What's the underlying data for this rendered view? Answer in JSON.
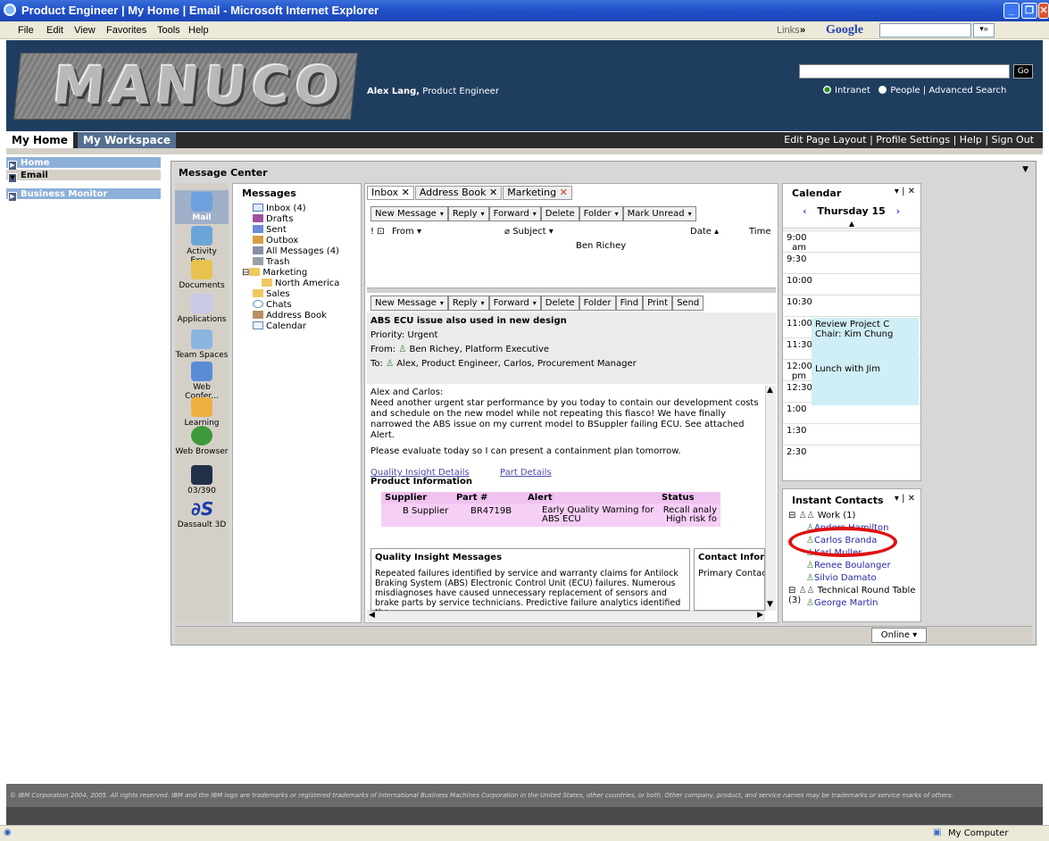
{
  "window": {
    "title": "Product Engineer | My Home | Email - Microsoft Internet Explorer"
  },
  "menu": {
    "items": [
      "File",
      "Edit",
      "View",
      "Favorites",
      "Tools",
      "Help"
    ],
    "links_label": "Links",
    "google_label": "Google"
  },
  "banner": {
    "logo_text": "MANUCO",
    "user_name": "Alex Lang,",
    "user_role": "Product Engineer",
    "go_label": "Go",
    "search_options": [
      "Intranet",
      "People"
    ],
    "advanced_search": "Advanced Search"
  },
  "nav": {
    "tab_home": "My Home",
    "tab_workspace": "My Workspace",
    "top_links": "Edit Page Layout | Profile Settings | Help | Sign Out"
  },
  "left_nav": [
    "Home",
    "Email",
    "Business Monitor"
  ],
  "message_center": {
    "title": "Message Center",
    "icons": [
      "Mail",
      "Activity Exp...",
      "Documents",
      "Applications",
      "Team Spaces",
      "Web Confer...",
      "Learning",
      "Web Browser",
      "03/390",
      "Dassault 3D"
    ],
    "folders_title": "Messages",
    "folders": [
      "Inbox (4)",
      "Drafts",
      "Sent",
      "Outbox",
      "All Messages (4)",
      "Trash",
      "Marketing",
      "North America",
      "Sales",
      "Chats",
      "Address Book",
      "Calendar"
    ],
    "tabs": [
      "Inbox",
      "Address Book",
      "Marketing"
    ],
    "toolbar1": [
      "New Message",
      "Reply",
      "Forward",
      "Delete",
      "Folder",
      "Mark Unread"
    ],
    "columns": [
      "From",
      "Subject",
      "Date",
      "Time"
    ],
    "list_sender": "Ben Richey",
    "toolbar2": [
      "New Message",
      "Reply",
      "Forward",
      "Delete",
      "Folder",
      "Find",
      "Print",
      "Send"
    ],
    "message": {
      "subject": "ABS ECU issue also used in new design",
      "priority": "Priority: Urgent",
      "from_label": "From:",
      "from": "Ben Richey, Platform Executive",
      "to_label": "To:",
      "to": "Alex, Product Engineer, Carlos, Procurement Manager",
      "greeting": "Alex and Carlos:",
      "body1": "Need another urgent star performance by you today to contain our development costs and schedule on the new model while not repeating this fiasco! We have finally narrowed the ABS issue on my current model to BSuppler failing ECU. See attached Alert.",
      "body2": "Please evaluate today so I can present a containment plan tomorrow.",
      "link1": "Quality Insight Details",
      "link2": "Part Details",
      "product_info": "Product Information",
      "table_headers": [
        "Supplier",
        "Part #",
        "Alert",
        "Status"
      ],
      "table_row": [
        "B Supplier",
        "BR4719B",
        "Early Quality Warning for ABS ECU",
        "Recall analy High risk fo"
      ]
    },
    "quality_title": "Quality Insight Messages",
    "quality_text": "Repeated failures identified by service and warranty claims for Antilock Braking System (ABS) Electronic Control Unit (ECU) failures. Numerous misdiagnoses have caused unnecessary replacement of sensors and brake parts by service technicians. Predictive failure analytics identified the",
    "contact_info_title": "Contact Informa",
    "contact_info_text": "Primary Contact",
    "online": "Online"
  },
  "calendar": {
    "title": "Calendar",
    "day": "Thursday 15",
    "times": [
      "9:00 am",
      "9:30",
      "10:00",
      "10:30",
      "11:00",
      "11:30",
      "12:00 pm",
      "12:30",
      "1:00",
      "1:30",
      "2:30"
    ],
    "events": [
      "Review Project C",
      "Chair: Kim Chung",
      "Lunch with Jim"
    ]
  },
  "contacts": {
    "title": "Instant Contacts",
    "group1": "Work (1)",
    "people1": [
      "Anders Hamilton",
      "Carlos Branda",
      "Karl Muller",
      "Renee Boulanger",
      "Silvio Damato"
    ],
    "group2": "Technical Round Table (3)",
    "people2": [
      "George Martin"
    ]
  },
  "footer": "© IBM Corporation 2004, 2005. All rights reserved. IBM and the IBM logo are trademarks or registered trademarks of International Business Machines Corporation in the United States, other countries, or both. Other company, product, and service names may be trademarks or service marks of others.",
  "statusbar": {
    "zone": "My Computer"
  }
}
